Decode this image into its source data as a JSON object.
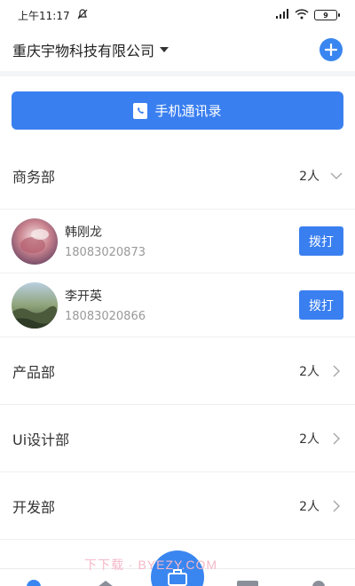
{
  "status": {
    "time": "上午11:17",
    "battery": "9"
  },
  "header": {
    "company": "重庆宇物科技有限公司"
  },
  "contacts_button": {
    "label": "手机通讯录"
  },
  "departments": [
    {
      "name": "商务部",
      "count": "2人",
      "expanded": true,
      "members": [
        {
          "name": "韩刚龙",
          "phone": "18083020873",
          "call_label": "拨打"
        },
        {
          "name": "李开英",
          "phone": "18083020866",
          "call_label": "拨打"
        }
      ]
    },
    {
      "name": "产品部",
      "count": "2人",
      "expanded": false
    },
    {
      "name": "Ui设计部",
      "count": "2人",
      "expanded": false
    },
    {
      "name": "开发部",
      "count": "2人",
      "expanded": false
    }
  ],
  "watermark": "下下载 · BYEZY.COM",
  "colors": {
    "accent": "#3a7ff0",
    "divider": "#eeeeee"
  },
  "icons": {
    "add": "plus-circle",
    "contacts": "address-book",
    "chevron_down": "chevron-down",
    "chevron_right": "chevron-right"
  }
}
